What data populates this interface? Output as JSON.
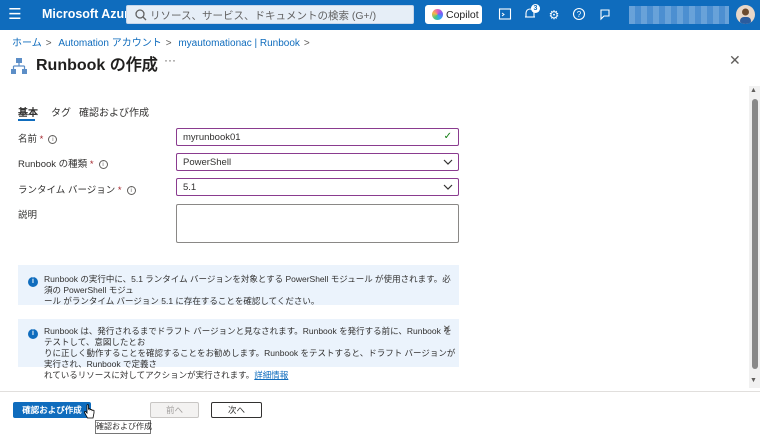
{
  "topbar": {
    "brand": "Microsoft Azure",
    "search_placeholder": "リソース、サービス、ドキュメントの検索 (G+/)",
    "copilot_label": "Copilot",
    "notification_count": "3",
    "accent_color": "#0f6cbd"
  },
  "breadcrumb": [
    "ホーム",
    "Automation アカウント",
    "myautomationac | Runbook"
  ],
  "page": {
    "title": "Runbook の作成",
    "more": "···",
    "close": "✕"
  },
  "tabs": [
    {
      "label": "基本",
      "active": true
    },
    {
      "label": "タグ",
      "active": false
    },
    {
      "label": "確認および作成",
      "active": false
    }
  ],
  "form": {
    "name": {
      "label": "名前",
      "required": "*",
      "value": "myrunbook01"
    },
    "type": {
      "label": "Runbook の種類",
      "required": "*",
      "value": "PowerShell"
    },
    "runtime": {
      "label": "ランタイム バージョン",
      "required": "*",
      "value": "5.1"
    },
    "description": {
      "label": "説明",
      "value": ""
    }
  },
  "info1": {
    "text_line1": "Runbook の実行中に、5.1 ランタイム バージョンを対象とする PowerShell モジュール が使用されます。必須の PowerShell モジュ",
    "text_line2": "ール がランタイム バージョン 5.1 に存在することを確認してください。"
  },
  "info2": {
    "text_line1": "Runbook は、発行されるまでドラフト バージョンと見なされます。Runbook を発行する前に、Runbook をテストして、意図したとお",
    "text_line2": "りに正しく動作することを確認することをお勧めします。Runbook をテストすると、ドラフト バージョンが実行され、Runbook で定義さ",
    "text_line3": "れているリソースに対してアクションが実行されます。",
    "link": "詳細情報"
  },
  "footer": {
    "review_create": "確認および作成",
    "previous": "前へ",
    "next": "次へ",
    "tooltip": "確認および作成"
  }
}
